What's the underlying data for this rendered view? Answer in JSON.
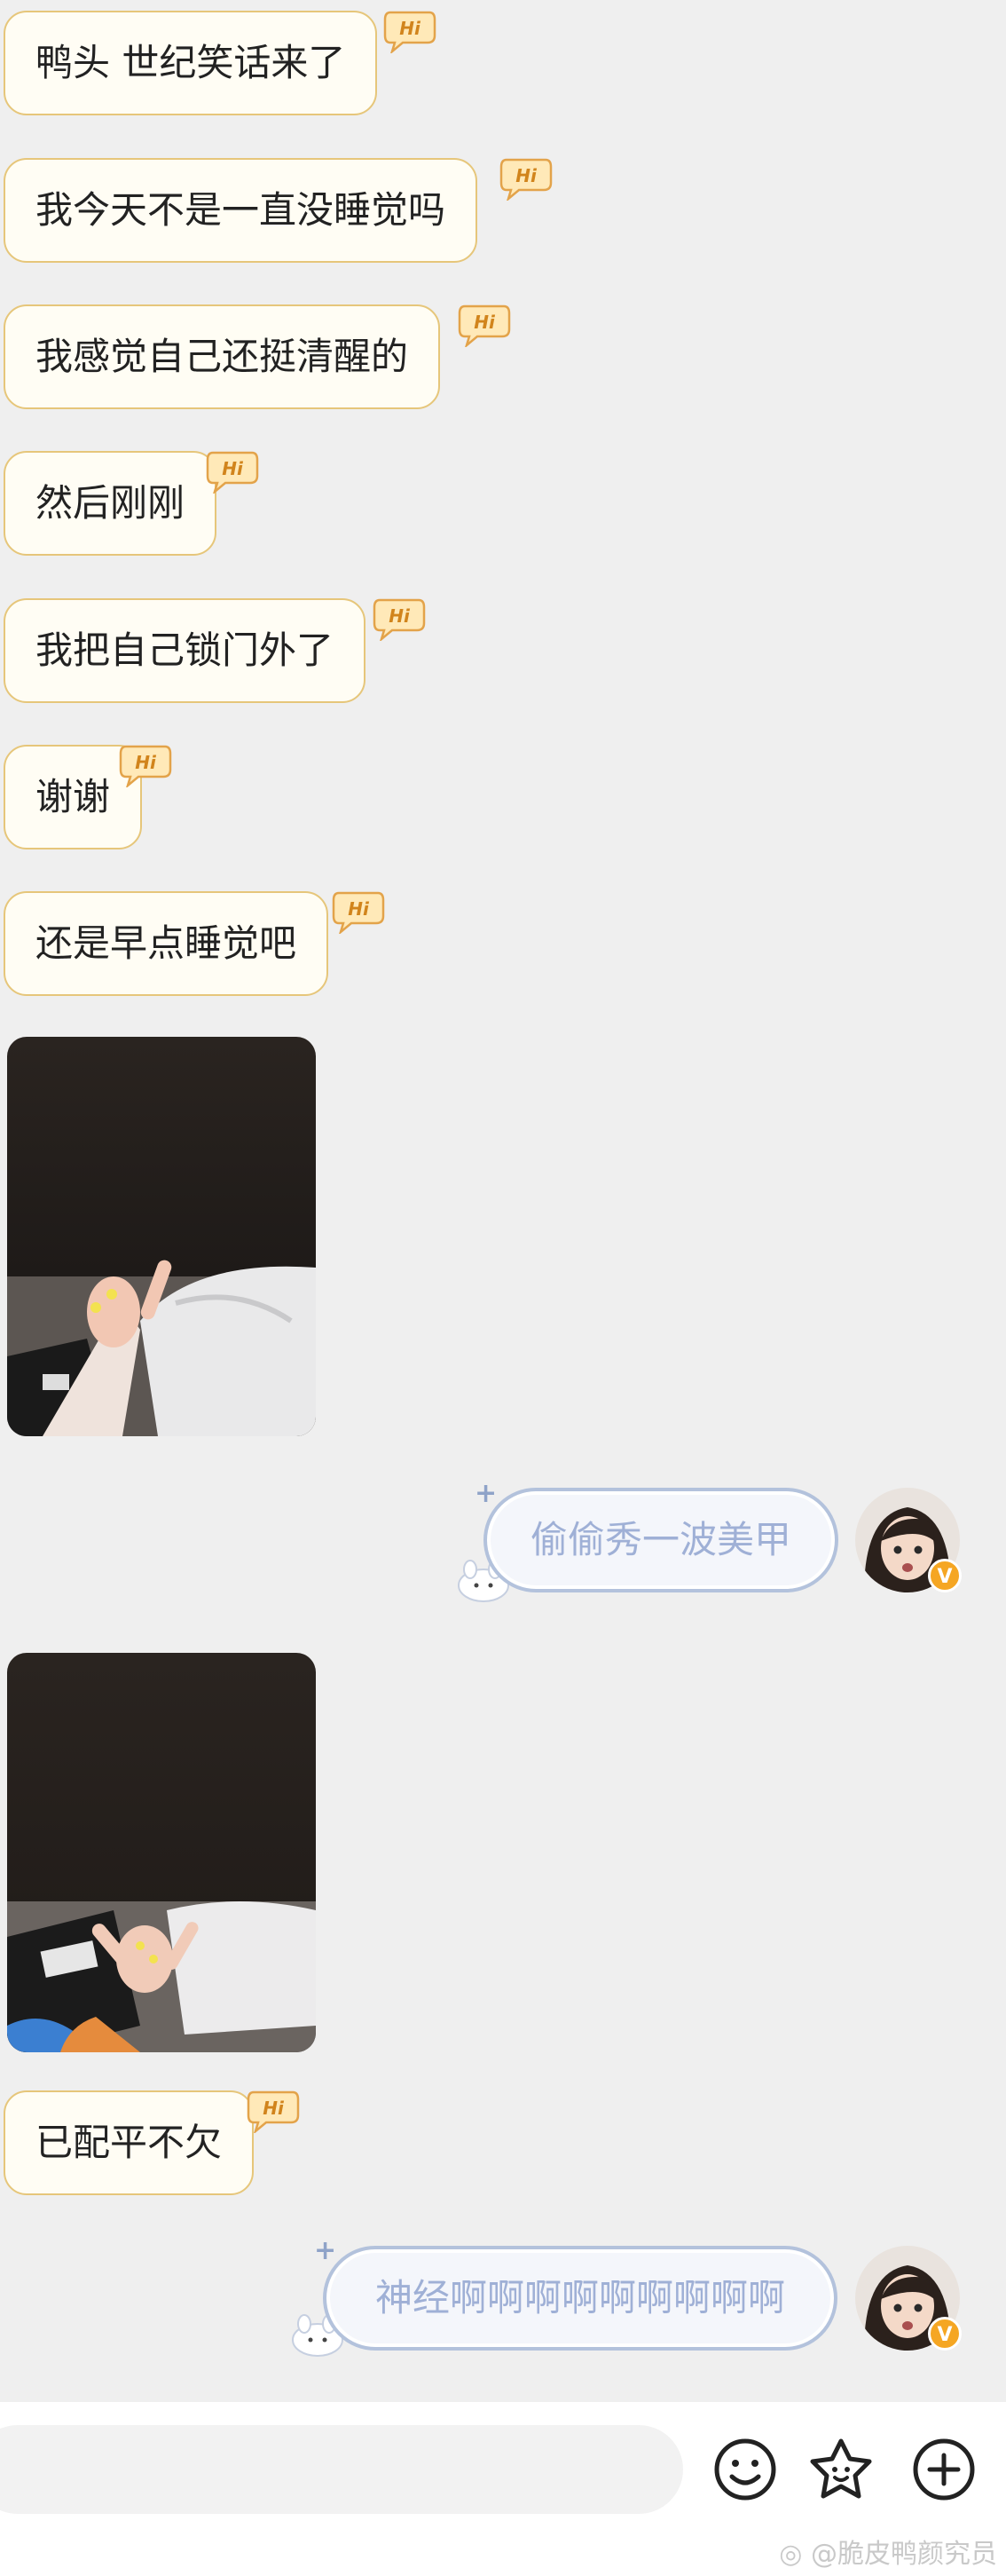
{
  "messages": [
    {
      "type": "received",
      "text": "鸭头 世纪笑话来了"
    },
    {
      "type": "received",
      "text": "我今天不是一直没睡觉吗"
    },
    {
      "type": "received",
      "text": "我感觉自己还挺清醒的"
    },
    {
      "type": "received",
      "text": "然后刚刚"
    },
    {
      "type": "received",
      "text": "我把自己锁门外了"
    },
    {
      "type": "received",
      "text": "谢谢"
    },
    {
      "type": "received",
      "text": "还是早点睡觉吧"
    },
    {
      "type": "received-image",
      "content": "photo of hand with middle finger and yellow nails over plastic bags"
    },
    {
      "type": "sent",
      "text": "偷偷秀一波美甲"
    },
    {
      "type": "received-image",
      "content": "photo of hand with nails over black and white bags"
    },
    {
      "type": "received",
      "text": "已配平不欠"
    },
    {
      "type": "sent",
      "text": "神经啊啊啊啊啊啊啊啊啊"
    }
  ],
  "hi_badge": "Hi",
  "verified_badge": "V",
  "colors": {
    "received_bubble_border": "#e6c67a",
    "sent_bubble_border": "#b3c2dc",
    "sent_text": "#9fb0d6",
    "badge_orange": "#f5a623"
  },
  "toolbar": {
    "icons": [
      "emoji-icon",
      "sticker-icon",
      "add-icon"
    ]
  },
  "watermark": "@脆皮鸭颜究员"
}
